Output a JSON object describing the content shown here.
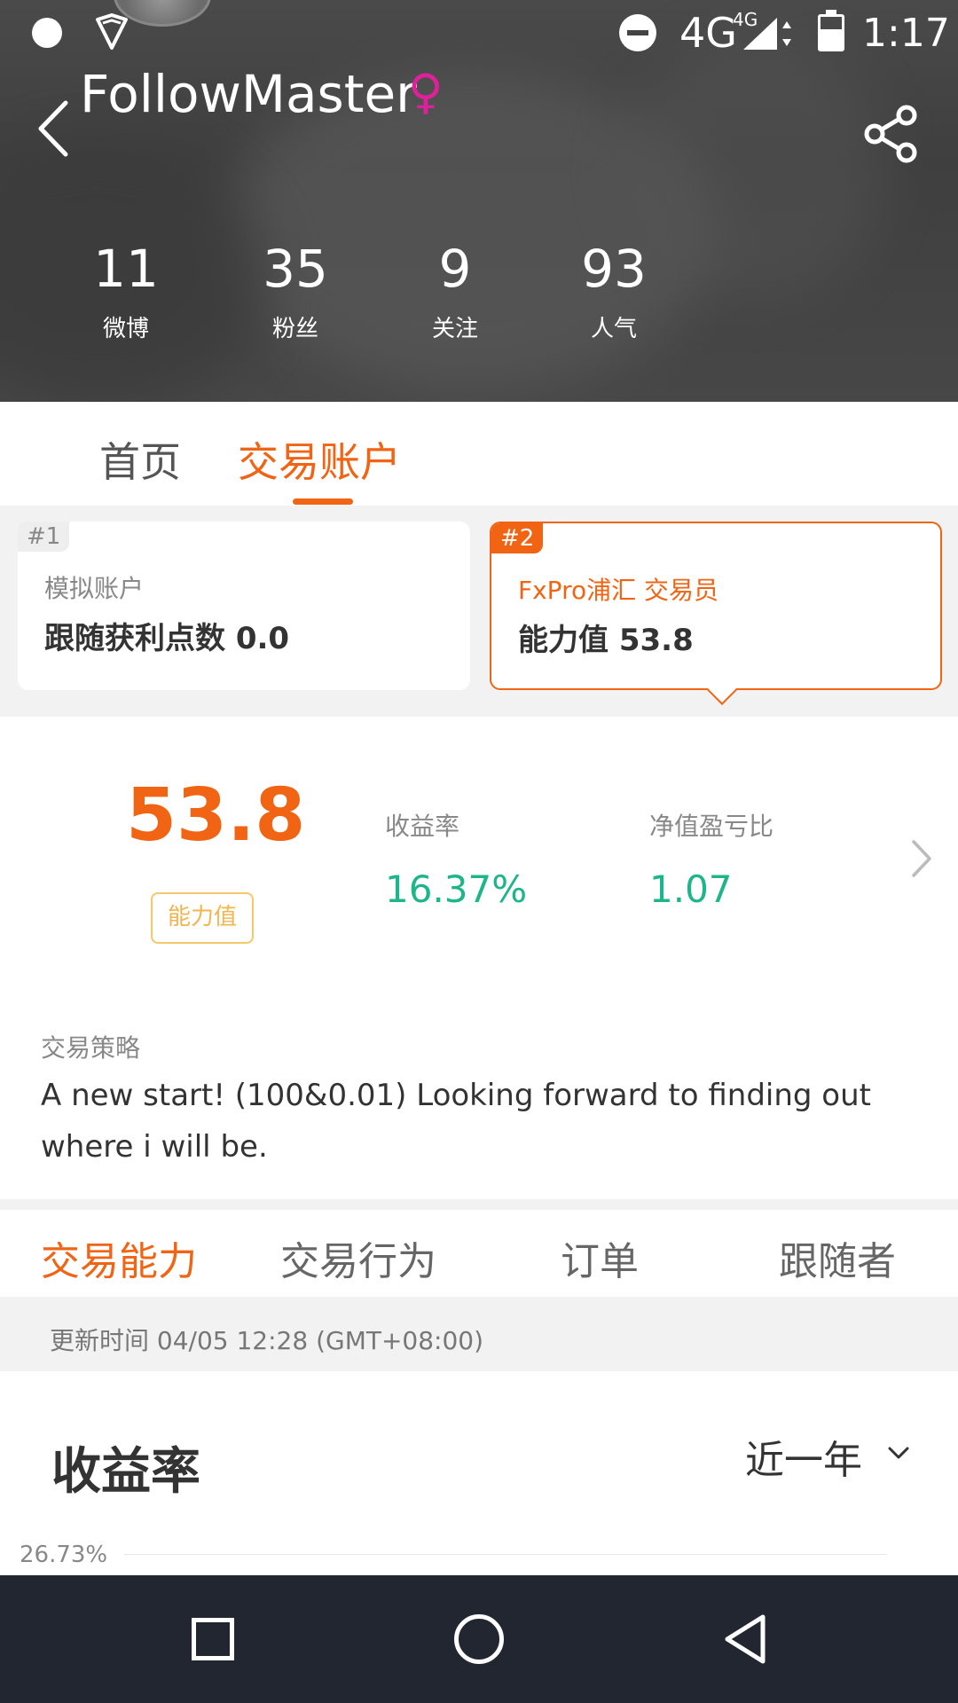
{
  "status_bar": {
    "network": "4G",
    "network_small": "4G",
    "time": "1:17"
  },
  "profile": {
    "name": "FollowMaster",
    "gender_symbol": "♀",
    "gender_color": "#e0209a",
    "stats": [
      {
        "value": "11",
        "label": "微博"
      },
      {
        "value": "35",
        "label": "粉丝"
      },
      {
        "value": "9",
        "label": "关注"
      },
      {
        "value": "93",
        "label": "人气"
      }
    ]
  },
  "tabs": {
    "home": "首页",
    "trade_account": "交易账户",
    "active": "交易账户"
  },
  "accounts": [
    {
      "badge": "#1",
      "title": "模拟账户",
      "value": "跟随获利点数 0.0"
    },
    {
      "badge": "#2",
      "title": "FxPro浦汇 交易员",
      "value": "能力值 53.8",
      "selected": true
    }
  ],
  "summary": {
    "score": "53.8",
    "score_label": "能力值",
    "return_label": "收益率",
    "return_value": "16.37%",
    "equity_label": "净值盈亏比",
    "equity_value": "1.07"
  },
  "strategy": {
    "label": "交易策略",
    "text": "A new start! (100&0.01) Looking forward to finding out where i will be."
  },
  "sub_tabs": [
    "交易能力",
    "交易行为",
    "订单",
    "跟随者"
  ],
  "update_time": "更新时间 04/05 12:28 (GMT+08:00)",
  "chart": {
    "title": "收益率",
    "range": "近一年",
    "y_tick": "26.73%"
  },
  "colors": {
    "accent": "#f06414",
    "positive": "#1db58a",
    "score_badge": "#f3b54f"
  }
}
